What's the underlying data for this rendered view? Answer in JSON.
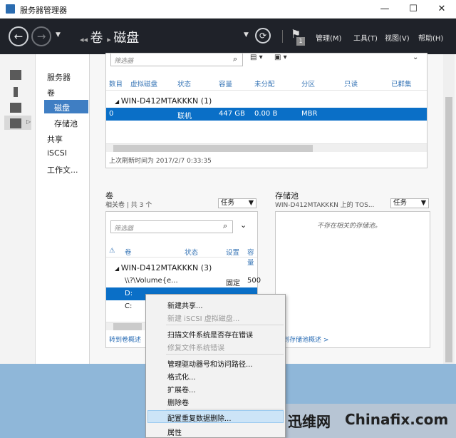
{
  "window": {
    "title": "服务器管理器",
    "controls": {
      "minimize": "—",
      "maximize": "☐",
      "close": "✕"
    }
  },
  "nav": {
    "breadcrumb": [
      "卷",
      "磁盘"
    ],
    "menus": [
      "管理(M)",
      "工具(T)",
      "视图(V)",
      "帮助(H)"
    ],
    "flag_badge": "1"
  },
  "tree": {
    "items": [
      "服务器",
      "卷",
      "磁盘",
      "存储池",
      "共享",
      "iSCSI",
      "工作文..."
    ],
    "selected": "磁盘"
  },
  "disks": {
    "filter_placeholder": "筛选器",
    "columns": [
      "数目",
      "虚拟磁盘",
      "状态",
      "容量",
      "未分配",
      "分区",
      "只读",
      "已群集"
    ],
    "group": "WIN-D412MTAKKKN (1)",
    "rows": [
      {
        "number": "0",
        "virtual": "",
        "status": "联机",
        "capacity": "447 GB",
        "unallocated": "0.00 B",
        "partition": "MBR"
      }
    ],
    "refresh_text": "上次刷新时间为 2017/2/7 0:33:35"
  },
  "volumes": {
    "title": "卷",
    "subtitle": "相关卷 | 共 3 个",
    "tasks_label": "任务",
    "filter_placeholder": "筛选器",
    "columns": [
      "卷",
      "状态",
      "设置",
      "容量"
    ],
    "group": "WIN-D412MTAKKKN (3)",
    "rows": [
      {
        "volume": "\\\\?\\Volume{e...",
        "status": "",
        "setting": "固定",
        "capacity": "500"
      },
      {
        "volume": "D:",
        "status": "",
        "setting": "",
        "capacity": ""
      },
      {
        "volume": "C:",
        "status": "",
        "setting": "",
        "capacity": ""
      }
    ],
    "goto_link": "转到卷概述"
  },
  "pools": {
    "title": "存储池",
    "subtitle": "WIN-D412MTAKKKN 上的 TOS...",
    "tasks_label": "任务",
    "empty_text": "不存在相关的存储池。",
    "goto_link": "到存储池概述 >"
  },
  "context_menu": {
    "items": [
      {
        "label": "新建共享...",
        "disabled": false
      },
      {
        "label": "新建 iSCSI 虚拟磁盘...",
        "disabled": true
      },
      {
        "label": "扫描文件系统是否存在错误",
        "disabled": false
      },
      {
        "label": "修复文件系统错误",
        "disabled": true
      },
      {
        "label": "管理驱动器号和访问路径...",
        "disabled": false
      },
      {
        "label": "格式化...",
        "disabled": false
      },
      {
        "label": "扩展卷...",
        "disabled": false
      },
      {
        "label": "删除卷",
        "disabled": false
      },
      {
        "label": "配置重复数据删除...",
        "disabled": false
      },
      {
        "label": "属性",
        "disabled": false
      }
    ],
    "highlighted": "配置重复数据删除..."
  },
  "watermark": {
    "text1": "迅维网",
    "text2": "Chinafix.com"
  },
  "colors": {
    "accent": "#0a6fc7",
    "nav_bg": "#1f2229",
    "tree_selected": "#3f7ec3",
    "link": "#2d6fb6"
  }
}
